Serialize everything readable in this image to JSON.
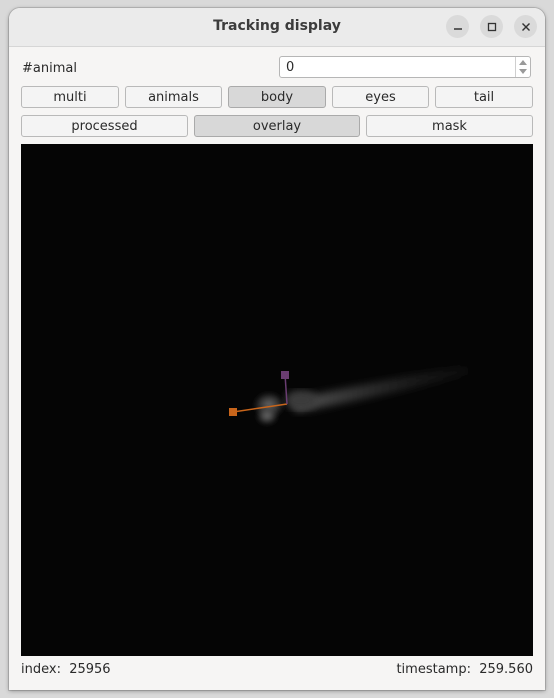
{
  "window": {
    "title": "Tracking display",
    "controls": [
      "minimize-icon",
      "maximize-icon",
      "close-icon"
    ]
  },
  "animal_selector": {
    "label": "#animal",
    "value": "0"
  },
  "layer_buttons": [
    {
      "label": "multi",
      "pressed": false
    },
    {
      "label": "animals",
      "pressed": false
    },
    {
      "label": "body",
      "pressed": true
    },
    {
      "label": "eyes",
      "pressed": false
    },
    {
      "label": "tail",
      "pressed": false
    }
  ],
  "view_buttons": [
    {
      "label": "processed",
      "pressed": false
    },
    {
      "label": "overlay",
      "pressed": true
    },
    {
      "label": "mask",
      "pressed": false
    }
  ],
  "overlay_colors": {
    "body_axis": "#c8651b",
    "heading_axis": "#6a3d72"
  },
  "status": {
    "index_label": "index:",
    "index_value": "25956",
    "timestamp_label": "timestamp:",
    "timestamp_value": "259.560"
  }
}
